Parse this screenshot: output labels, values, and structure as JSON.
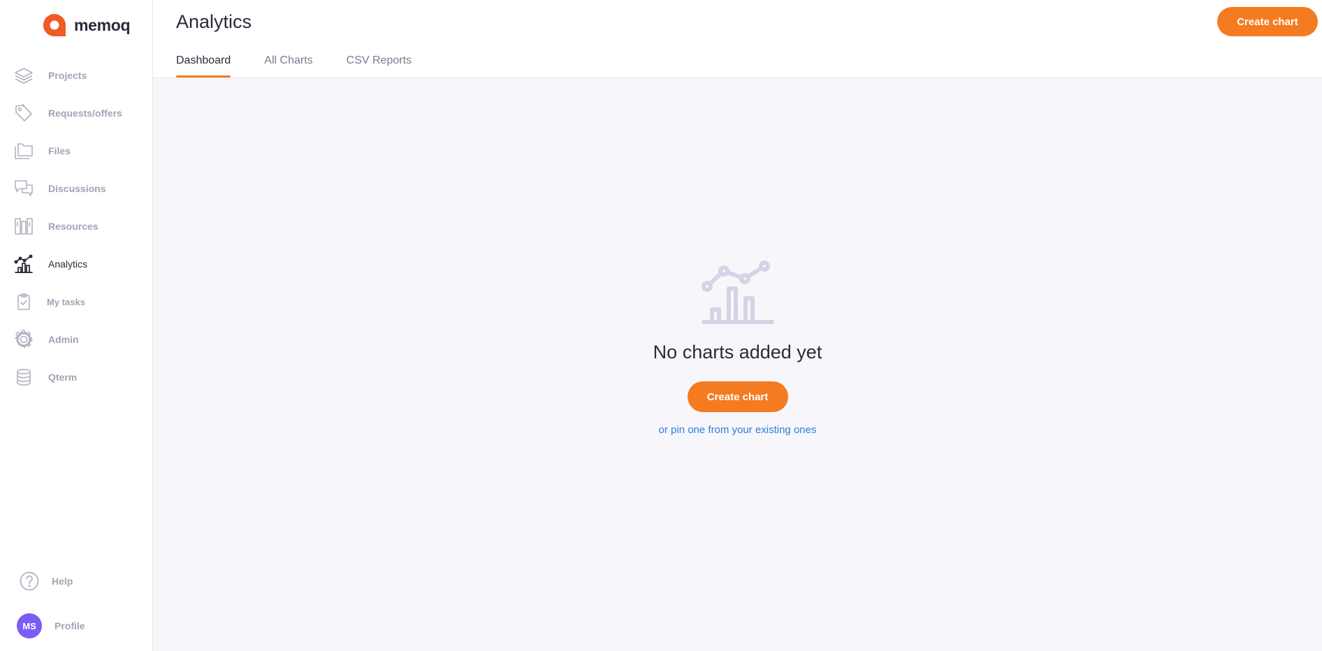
{
  "app": {
    "brand": "memoq",
    "accent": "#f47b20"
  },
  "sidebar": {
    "items": [
      {
        "label": "Projects",
        "icon": "layers-icon",
        "active": false
      },
      {
        "label": "Requests/offers",
        "icon": "tag-icon",
        "active": false
      },
      {
        "label": "Files",
        "icon": "folder-icon",
        "active": false
      },
      {
        "label": "Discussions",
        "icon": "chat-icon",
        "active": false
      },
      {
        "label": "Resources",
        "icon": "library-icon",
        "active": false
      },
      {
        "label": "Analytics",
        "icon": "analytics-icon",
        "active": true
      },
      {
        "label": "My tasks",
        "icon": "clipboard-check-icon",
        "active": false
      },
      {
        "label": "Admin",
        "icon": "gear-icon",
        "active": false
      },
      {
        "label": "Qterm",
        "icon": "database-icon",
        "active": false
      }
    ],
    "help": {
      "label": "Help",
      "icon": "help-circle-icon"
    },
    "profile": {
      "label": "Profile",
      "initials": "MS",
      "avatar_color": "#7b5cf5"
    }
  },
  "header": {
    "title": "Analytics",
    "create_button": "Create chart",
    "tabs": [
      {
        "label": "Dashboard",
        "active": true
      },
      {
        "label": "All Charts",
        "active": false
      },
      {
        "label": "CSV Reports",
        "active": false
      }
    ]
  },
  "empty_state": {
    "icon": "chart-placeholder-icon",
    "title": "No charts added yet",
    "button": "Create chart",
    "link": "or pin one from your existing ones"
  }
}
